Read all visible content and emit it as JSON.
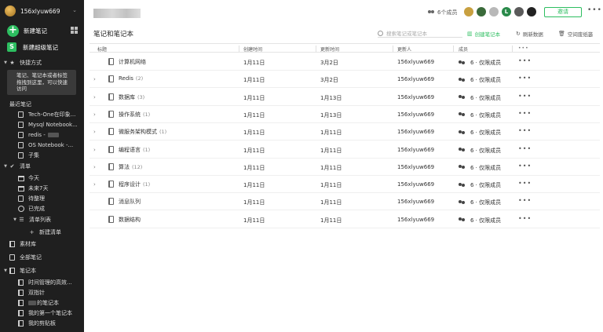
{
  "sidebar": {
    "username": "156xlyuw669",
    "new_note": "新建笔记",
    "new_super_note": "新建超级笔记",
    "shortcuts": {
      "label": "快捷方式",
      "hint": "笔记、笔记本或者标签拖拽到这里，可以快速访问"
    },
    "recent": {
      "label": "最近笔记",
      "items": [
        "Tech-One在印象...",
        "Mysql Notebook...",
        "redis -",
        "OS Notebook -...",
        "子集"
      ]
    },
    "checklist": {
      "label": "清单",
      "items": [
        "今天",
        "未来7天",
        "待整理",
        "已完成"
      ],
      "list_group": "清单列表",
      "new_list": "新建清单"
    },
    "materials": "素材库",
    "all_notes": "全部笔记",
    "notebooks": {
      "label": "笔记本",
      "items": [
        "时间管理的高效...",
        "双指针",
        "的笔记本",
        "我的第一个笔记本",
        "我的剪贴板"
      ]
    }
  },
  "header": {
    "members_count": "6个成员",
    "avatar_l": "L",
    "invite_label": "邀请",
    "more": "•••"
  },
  "toolbar": {
    "title": "笔记和笔记本",
    "search_placeholder": "搜索笔记或笔记本",
    "create_notebook": "创建笔记本",
    "refresh": "刷新数据",
    "space_recycle": "空间废纸篓"
  },
  "table": {
    "columns": [
      "标题",
      "创建时间",
      "更新时间",
      "更新人",
      "成员"
    ],
    "rows": [
      {
        "title": "计算机网络",
        "count": "",
        "expandable": false,
        "created": "1月11日",
        "updated": "3月2日",
        "updater": "156xlyuw669",
        "members": "6 · 仅限成员"
      },
      {
        "title": "Redis",
        "count": "(2)",
        "expandable": true,
        "created": "1月11日",
        "updated": "3月2日",
        "updater": "156xlyuw669",
        "members": "6 · 仅限成员"
      },
      {
        "title": "数据库",
        "count": "(3)",
        "expandable": true,
        "created": "1月11日",
        "updated": "1月13日",
        "updater": "156xlyuw669",
        "members": "6 · 仅限成员"
      },
      {
        "title": "操作系统",
        "count": "(1)",
        "expandable": true,
        "created": "1月11日",
        "updated": "1月13日",
        "updater": "156xlyuw669",
        "members": "6 · 仅限成员"
      },
      {
        "title": "微服务架构模式",
        "count": "(1)",
        "expandable": true,
        "created": "1月11日",
        "updated": "1月11日",
        "updater": "156xlyuw669",
        "members": "6 · 仅限成员"
      },
      {
        "title": "编程语言",
        "count": "(1)",
        "expandable": true,
        "created": "1月11日",
        "updated": "1月11日",
        "updater": "156xlyuw669",
        "members": "6 · 仅限成员"
      },
      {
        "title": "算法",
        "count": "(12)",
        "expandable": true,
        "created": "1月11日",
        "updated": "1月11日",
        "updater": "156xlyuw669",
        "members": "6 · 仅限成员"
      },
      {
        "title": "程序设计",
        "count": "(1)",
        "expandable": true,
        "created": "1月11日",
        "updated": "1月11日",
        "updater": "156xlyuw669",
        "members": "6 · 仅限成员"
      },
      {
        "title": "消息队列",
        "count": "",
        "expandable": false,
        "created": "1月11日",
        "updated": "1月11日",
        "updater": "156xlyuw669",
        "members": "6 · 仅限成员"
      },
      {
        "title": "数据结构",
        "count": "",
        "expandable": false,
        "created": "1月11日",
        "updated": "1月11日",
        "updater": "156xlyuw669",
        "members": "6 · 仅限成员"
      }
    ]
  },
  "colors": {
    "accent": "#2dbe60",
    "sidebar_bg": "#1f1f1f"
  }
}
